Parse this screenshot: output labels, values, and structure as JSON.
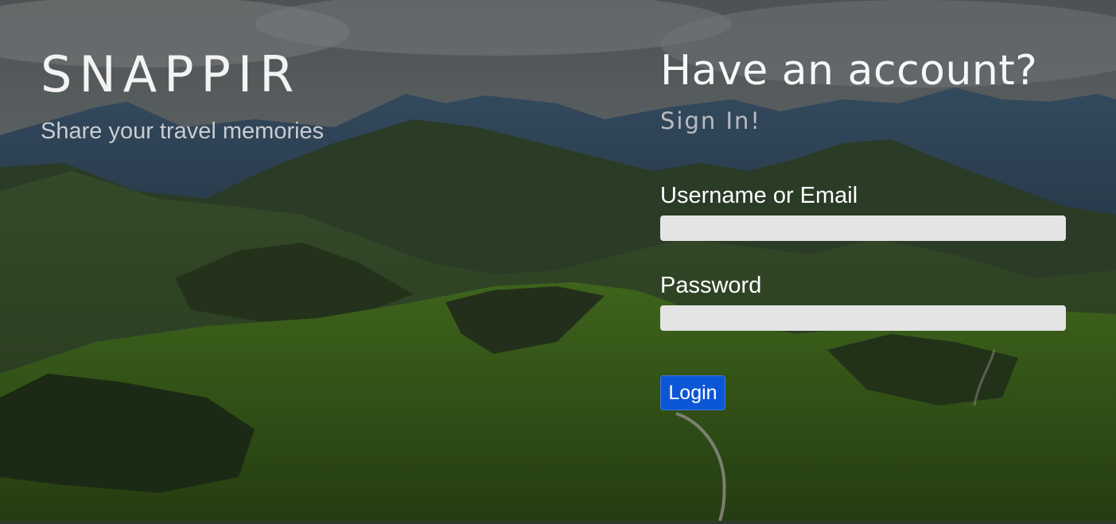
{
  "brand": {
    "title": "SNAPPIR",
    "tagline": "Share your travel memories"
  },
  "login": {
    "heading": "Have an account?",
    "subheading": "Sign In!",
    "username_label": "Username or Email",
    "username_value": "",
    "password_label": "Password",
    "password_value": "",
    "submit_label": "Login"
  },
  "colors": {
    "button": "#0c57d6",
    "input_bg": "#e4e4e4"
  }
}
